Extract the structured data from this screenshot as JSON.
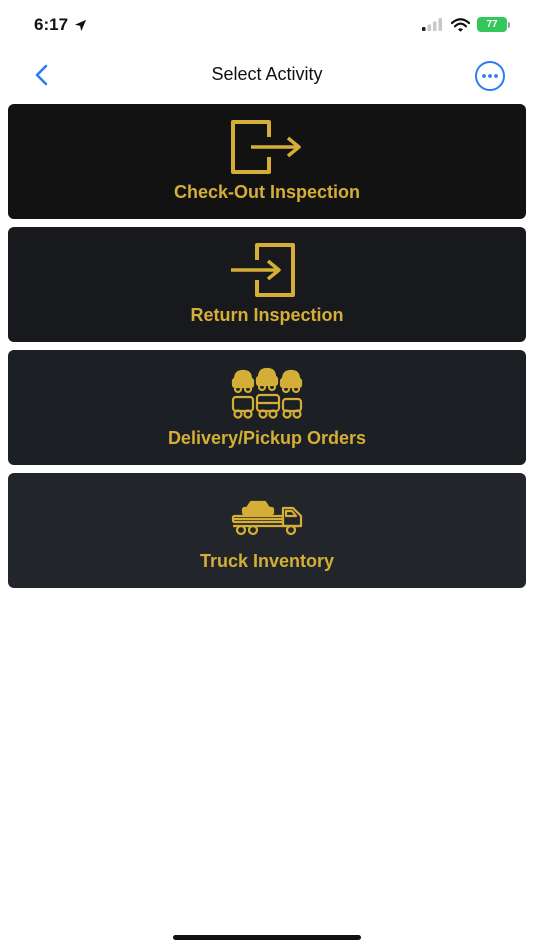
{
  "status_bar": {
    "time": "6:17",
    "battery_level": "77"
  },
  "nav": {
    "title": "Select Activity",
    "back_icon": "chevron-left-icon",
    "more_icon": "ellipsis-circle-icon"
  },
  "activities": [
    {
      "label": "Check-Out Inspection",
      "icon": "exit-door-icon"
    },
    {
      "label": "Return Inspection",
      "icon": "enter-door-icon"
    },
    {
      "label": "Delivery/Pickup Orders",
      "icon": "vehicles-icon"
    },
    {
      "label": "Truck Inventory",
      "icon": "truck-icon"
    }
  ],
  "colors": {
    "accent_gold": "#d4ae37",
    "ios_blue": "#2f7bf6",
    "battery_green": "#34c759"
  }
}
